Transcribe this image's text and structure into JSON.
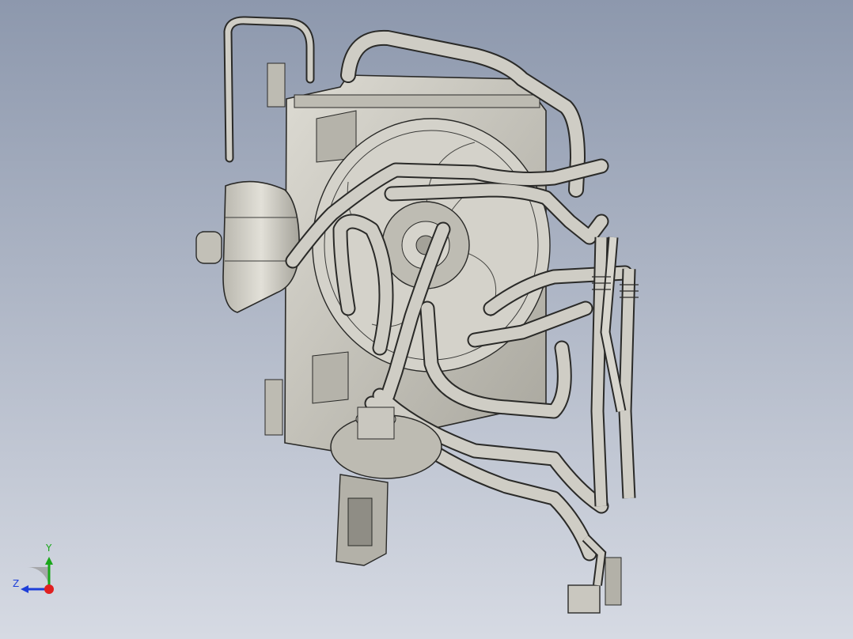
{
  "colors": {
    "background_top": "#8d98ad",
    "background_bottom": "#d6dae3",
    "part_fill": "#c9c7bf",
    "part_shade": "#a4a299",
    "part_edge": "#2a2a28",
    "axis_x": "#e02020",
    "axis_y": "#19a619",
    "axis_z": "#1e3fd8"
  },
  "viewport": {
    "model_icon": "cooling-module-assembly"
  },
  "triad": {
    "y_label": "Y",
    "z_label": "Z"
  }
}
